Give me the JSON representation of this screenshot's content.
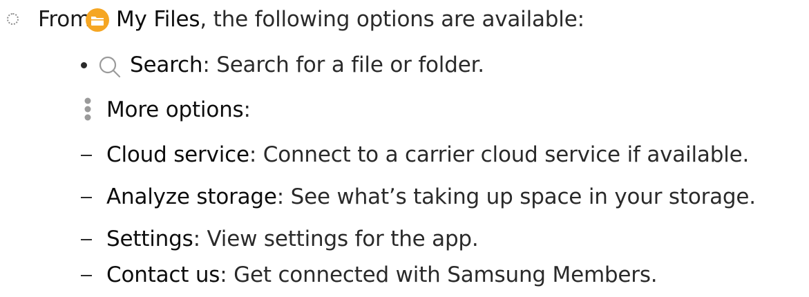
{
  "intro": {
    "prefix": "From",
    "app_icon": "folder-icon",
    "app_name": "My Files",
    "suffix": ", the following options are available:"
  },
  "options": [
    {
      "icon": "search-icon",
      "term": "Search",
      "description": ": Search for a file or folder."
    },
    {
      "icon": "more-options-icon",
      "term": "More options",
      "description": ":"
    }
  ],
  "more_options": [
    {
      "term": "Cloud service",
      "description": ": Connect to a carrier cloud service if available."
    },
    {
      "term": "Analyze storage",
      "description": ": See what’s taking up space in your storage."
    },
    {
      "term": "Settings",
      "description": ": View settings for the app."
    },
    {
      "term": "Contact us",
      "description": ": Get connected with Samsung Members."
    }
  ],
  "colors": {
    "app_icon": "#F5A623",
    "icon_gray": "#9a9a9a",
    "text": "#1a1a1a"
  }
}
